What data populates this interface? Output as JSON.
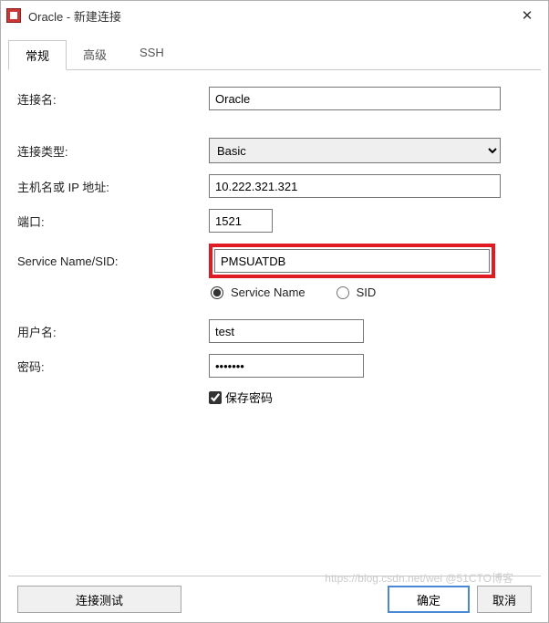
{
  "window": {
    "title": "Oracle - 新建连接",
    "close_glyph": "✕"
  },
  "tabs": {
    "general": "常规",
    "advanced": "高级",
    "ssh": "SSH"
  },
  "labels": {
    "conn_name": "连接名:",
    "conn_type": "连接类型:",
    "host": "主机名或 IP 地址:",
    "port": "端口:",
    "service_sid": "Service Name/SID:",
    "username": "用户名:",
    "password": "密码:",
    "save_password": "保存密码"
  },
  "values": {
    "conn_name": "Oracle",
    "conn_type": "Basic",
    "host": "10.222.321.321",
    "port": "1521",
    "service_sid": "PMSUATDB",
    "username": "test",
    "password": "•••••••",
    "service_name_radio": "Service Name",
    "sid_radio": "SID",
    "save_password_checked": true
  },
  "buttons": {
    "test": "连接测试",
    "ok": "确定",
    "cancel": "取消"
  },
  "watermark": "https://blog.csdn.net/wei @51CTO博客"
}
